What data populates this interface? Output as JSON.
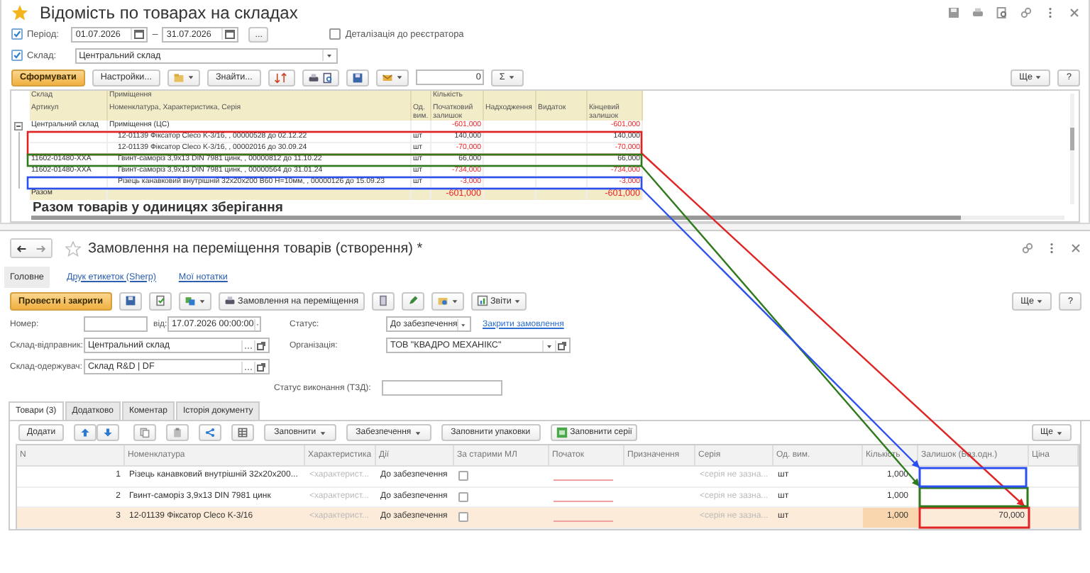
{
  "report_window": {
    "title": "Відомість по товарах на складах",
    "period": {
      "checked": true,
      "label": "Період:",
      "from": "01.07.2026",
      "separator": "–",
      "to": "31.07.2026",
      "more": "..."
    },
    "detail": {
      "checked": false,
      "label": "Деталізація до реєстратора"
    },
    "warehouse": {
      "checked": true,
      "label": "Склад:",
      "value": "Центральний склад"
    },
    "toolbar": {
      "generate": "Сформувати",
      "settings": "Настройки...",
      "find": "Знайти...",
      "number": "0",
      "sigma": "Σ",
      "more": "Ще",
      "help": "?"
    },
    "report": {
      "header_top": [
        "Склад",
        "Приміщення",
        "Кількість"
      ],
      "header_bottom": [
        "Артикул",
        "Номенклатура, Характеристика, Серія",
        "Од. вим.",
        "Початковий залишок",
        "Надходження",
        "Видаток",
        "Кінцевий залишок"
      ],
      "rows": [
        {
          "warehouse": "Центральний склад",
          "item": "Приміщення (ЦС)",
          "start": "-601,000",
          "end": "-601,000",
          "negative": true,
          "expanded": true,
          "children": [
            {
              "item": "12-01139 Фіксатор Cleco K-3/16, , 00000528 до 02.12.22",
              "unit": "шт",
              "start": "140,000",
              "end": "140,000",
              "negative": false
            },
            {
              "item": "12-01139 Фіксатор Cleco K-3/16, , 00002016 до 30.09.24",
              "unit": "шт",
              "start": "-70,000",
              "end": "-70,000",
              "negative": true
            },
            {
              "article": "11602-01480-XXA",
              "item": "Гвинт-саморіз 3,9х13 DIN 7981 цинк, , 00000812 до 11.10.22",
              "unit": "шт",
              "start": "66,000",
              "end": "66,000",
              "negative": false
            },
            {
              "article": "11602-01480-XXA",
              "item": "Гвинт-саморіз 3,9х13 DIN 7981 цинк, , 00000564 до 31.01.24",
              "unit": "шт",
              "start": "-734,000",
              "end": "-734,000",
              "negative": true
            },
            {
              "item": "Різець канавковий внутрішній 32х20х200 В60 H=10мм, , 00000126 до 15.09.23",
              "unit": "шт",
              "start": "-3,000",
              "end": "-3,000",
              "negative": true
            }
          ]
        }
      ],
      "total": {
        "label": "Разом",
        "start": "-601,000",
        "end": "-601,000",
        "negative": true
      },
      "subtitle": "Разом товарів у одиницях зберігання"
    }
  },
  "order_window": {
    "title": "Замовлення на переміщення товарів (створення) *",
    "sections": [
      {
        "label": "Головне",
        "selected": true
      },
      {
        "label": "Друк етикеток (Sherp)",
        "selected": false
      },
      {
        "label": "Мої нотатки",
        "selected": false
      }
    ],
    "toolbar": {
      "post": "Провести і закрити",
      "transfer": "Замовлення на переміщення",
      "reports": "Звіти",
      "more": "Ще",
      "help": "?"
    },
    "number": {
      "label": "Номер:",
      "date_label": "від:",
      "date": "17.07.2026 00:00:00"
    },
    "status": {
      "label": "Статус:",
      "value": "До забезпечення",
      "link": "Закрити замовлення"
    },
    "sender": {
      "label": "Склад-відправник:",
      "value": "Центральний склад"
    },
    "organization": {
      "label": "Організація:",
      "value": "ТОВ \"КВАДРО МЕХАНІКС\""
    },
    "receiver": {
      "label": "Склад-одержувач:",
      "value": "Склад R&D | DF"
    },
    "execution": {
      "label": "Статус виконання (ТЗД):"
    },
    "tabs": [
      {
        "label": "Товари (3)",
        "selected": true
      },
      {
        "label": "Додатково",
        "selected": false
      },
      {
        "label": "Коментар",
        "selected": false
      },
      {
        "label": "Історія документу",
        "selected": false
      }
    ],
    "table_toolbar": {
      "add": "Додати",
      "fill": "Заповнити",
      "provision": "Забезпечення",
      "fill_packs": "Заповнити упаковки",
      "fill_series": "Заповнити серії",
      "more": "Ще"
    },
    "table": {
      "columns": [
        "N",
        "Номенклатура",
        "Характеристика",
        "Дії",
        "За старими МЛ",
        "Початок",
        "Призначення",
        "Серія",
        "Од. вим.",
        "Кількість",
        "Залишок (Баз.одн.)",
        "Ціна"
      ],
      "rows": [
        {
          "n": "1",
          "item": "Різець канавковий внутрішній 32х20х200...",
          "characteristic": "<характерист...",
          "action": "До забезпечення",
          "old_ml": false,
          "series": "<серія не зазна...",
          "unit": "шт",
          "qty": "1,000",
          "selected": false
        },
        {
          "n": "2",
          "item": "Гвинт-саморіз 3,9х13 DIN 7981 цинк",
          "characteristic": "<характерист...",
          "action": "До забезпечення",
          "old_ml": false,
          "series": "<серія не зазна...",
          "unit": "шт",
          "qty": "1,000",
          "selected": false
        },
        {
          "n": "3",
          "item": "12-01139 Фіксатор Cleco K-3/16",
          "characteristic": "<характерист...",
          "action": "До забезпечення",
          "old_ml": false,
          "series": "<серія не зазна...",
          "unit": "шт",
          "qty": "1,000",
          "stock": "70,000",
          "selected": true
        }
      ]
    }
  },
  "annotations": [
    {
      "color": "#e02424"
    },
    {
      "color": "#2f7a1c"
    },
    {
      "color": "#2c4ff0"
    }
  ]
}
